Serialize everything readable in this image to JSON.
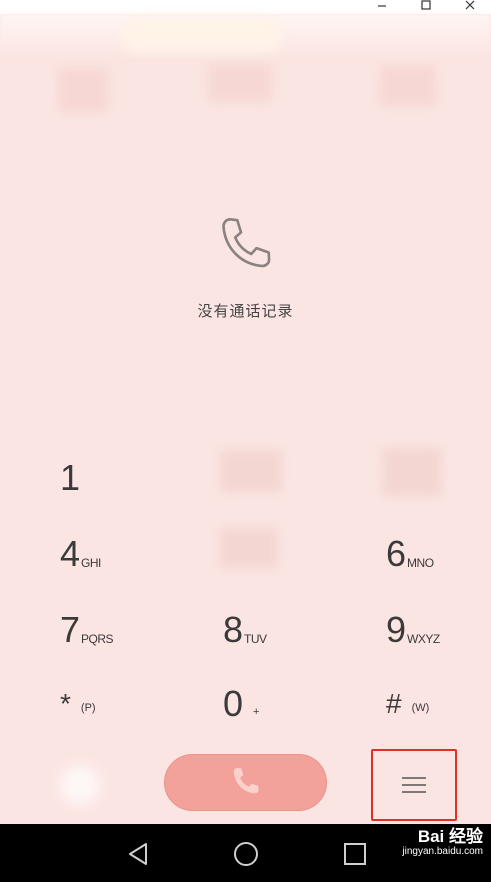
{
  "empty_state": {
    "text": "没有通话记录",
    "icon": "phone-outline-icon"
  },
  "keypad": {
    "row1": {
      "k1": {
        "digit": "1",
        "letters": ""
      }
    },
    "row2": {
      "k4": {
        "digit": "4",
        "letters": "GHI"
      },
      "k6": {
        "digit": "6",
        "letters": "MNO"
      }
    },
    "row3": {
      "k7": {
        "digit": "7",
        "letters": "PQRS"
      },
      "k8": {
        "digit": "8",
        "letters": "TUV"
      },
      "k9": {
        "digit": "9",
        "letters": "WXYZ"
      }
    },
    "row4": {
      "star": {
        "symbol": "*",
        "sub": "(P)"
      },
      "k0": {
        "digit": "0",
        "sub": "+"
      },
      "hash": {
        "symbol": "#",
        "sub": "(W)"
      }
    }
  },
  "actions": {
    "call_icon": "phone-icon",
    "menu_icon": "hamburger-menu-icon"
  },
  "navbar": {
    "back_icon": "back-triangle-icon",
    "home_icon": "home-circle-icon",
    "recents_icon": "recents-square-icon"
  },
  "watermark": {
    "title": "Bai 经验",
    "url": "jingyan.baidu.com"
  },
  "colors": {
    "background": "#fbe5e2",
    "call_button": "#f2a19b",
    "highlight_box": "#e0302a"
  }
}
